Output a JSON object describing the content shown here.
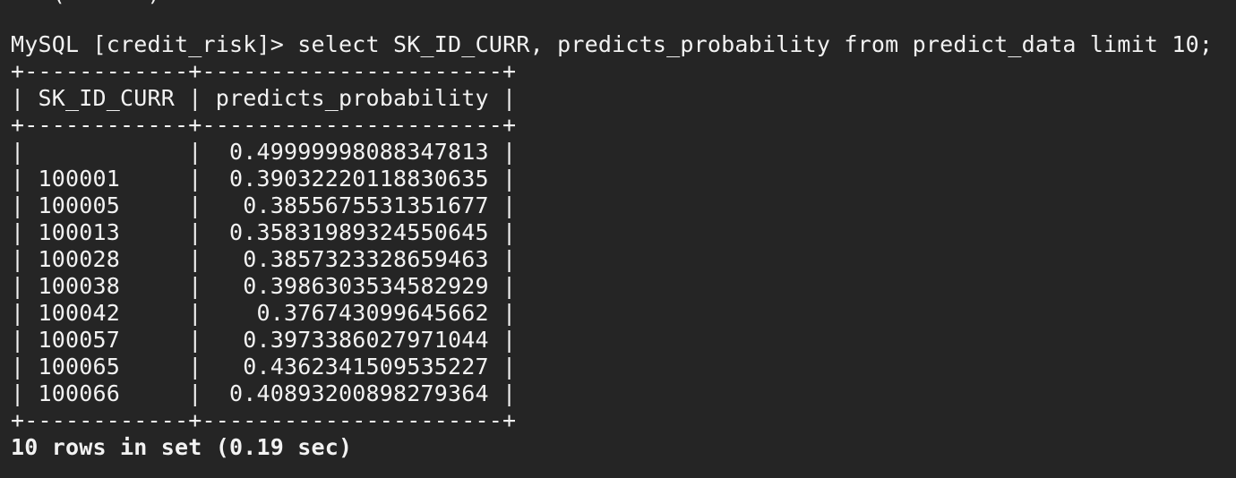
{
  "terminal": {
    "scrolled_line": "   (      )",
    "prompt": "MySQL [credit_risk]>",
    "command": "select SK_ID_CURR, predicts_probability from predict_data limit 10;",
    "status": "10 rows in set (0.19 sec)"
  },
  "result_table": {
    "columns": [
      "SK_ID_CURR",
      "predicts_probability"
    ],
    "border_top": "+------------+----------------------+",
    "header_line": "| SK_ID_CURR | predicts_probability |",
    "border_mid": "+------------+----------------------+",
    "rows": [
      {
        "sk_id_curr": "",
        "predicts_probability": "0.49999998088347813",
        "line": "|            |  0.49999998088347813 |"
      },
      {
        "sk_id_curr": "100001",
        "predicts_probability": "0.39032220118830635",
        "line": "| 100001     |  0.39032220118830635 |"
      },
      {
        "sk_id_curr": "100005",
        "predicts_probability": "0.3855675531351677",
        "line": "| 100005     |   0.3855675531351677 |"
      },
      {
        "sk_id_curr": "100013",
        "predicts_probability": "0.35831989324550645",
        "line": "| 100013     |  0.35831989324550645 |"
      },
      {
        "sk_id_curr": "100028",
        "predicts_probability": "0.3857323328659463",
        "line": "| 100028     |   0.3857323328659463 |"
      },
      {
        "sk_id_curr": "100038",
        "predicts_probability": "0.3986303534582929",
        "line": "| 100038     |   0.3986303534582929 |"
      },
      {
        "sk_id_curr": "100042",
        "predicts_probability": "0.37674309964566​2",
        "line": "| 100042     |    0.37674309964566​2 |"
      },
      {
        "sk_id_curr": "100057",
        "predicts_probability": "0.3973386027971044",
        "line": "| 100057     |   0.3973386027971044 |"
      },
      {
        "sk_id_curr": "100065",
        "predicts_probability": "0.4362341509535227",
        "line": "| 100065     |   0.4362341509535227 |"
      },
      {
        "sk_id_curr": "100066",
        "predicts_probability": "0.40893200898279364",
        "line": "| 100066     |  0.40893200898279364 |"
      }
    ],
    "border_bottom": "+------------+----------------------+"
  }
}
